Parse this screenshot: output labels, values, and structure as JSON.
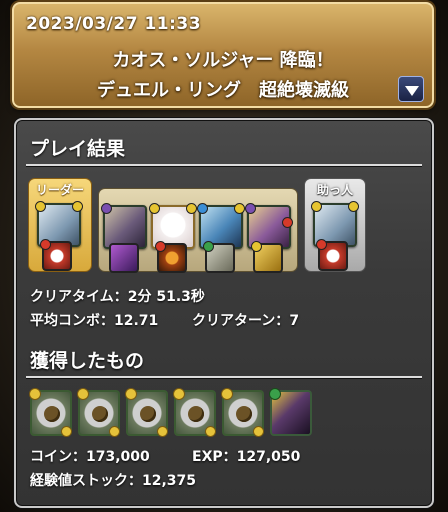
{
  "header": {
    "datetime": "2023/03/27 11:33",
    "title_line1": "カオス・ソルジャー 降臨！",
    "title_line2": "デュエル・リング　超絶壊滅級"
  },
  "result": {
    "section_title": "プレイ結果",
    "leader_label": "リーダー",
    "helper_label": "助っ人",
    "clear_time_label": "クリアタイム：",
    "clear_time_value": "2分 51.3秒",
    "avg_combo_label": "平均コンボ：",
    "avg_combo_value": "12.71",
    "clear_turn_label": "クリアターン：",
    "clear_turn_value": "7"
  },
  "obtained": {
    "section_title": "獲得したもの",
    "coin_label": "コイン：",
    "coin_value": "173,000",
    "exp_label": "EXP：",
    "exp_value": "127,050",
    "exp_stock_label": "経験値ストック：",
    "exp_stock_value": "12,375"
  },
  "team": {
    "leader": {
      "monster_icon": "white-dragon-icon",
      "assist_icon": "red-creature-icon",
      "color": "#9fb7c9"
    },
    "subs": [
      {
        "monster_icon": "dark-mage-icon",
        "assist_icon": "purple-demon-icon",
        "color": "#8e7fa3"
      },
      {
        "monster_icon": "white-cat-character-icon",
        "assist_icon": "fire-creature-icon",
        "color": "#f0eaea"
      },
      {
        "monster_icon": "blue-hair-warrior-icon",
        "assist_icon": "armored-knight-icon",
        "color": "#5f8fb8"
      },
      {
        "monster_icon": "witch-girl-icon",
        "assist_icon": "golden-dragon-icon",
        "color": "#b79a5a"
      }
    ],
    "helper": {
      "monster_icon": "white-dragon-icon",
      "assist_icon": "red-creature-icon",
      "color": "#9fb7c9"
    }
  },
  "drops": [
    {
      "icon": "egg-plate-icon"
    },
    {
      "icon": "egg-plate-icon"
    },
    {
      "icon": "egg-plate-icon"
    },
    {
      "icon": "egg-plate-icon"
    },
    {
      "icon": "egg-plate-icon"
    },
    {
      "icon": "dark-dragon-icon"
    }
  ],
  "colors": {
    "gold": "#c7a050",
    "panel": "#3a3a3a"
  }
}
